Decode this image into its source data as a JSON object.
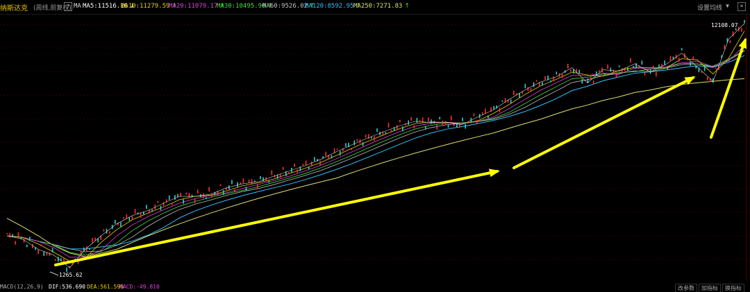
{
  "header": {
    "title": "纳斯达克",
    "subtitle": "(周线,前复权)",
    "help": "?",
    "ma_label": "MA",
    "ma": [
      {
        "label": "MA5:11516.10",
        "arrow": "↓",
        "color": "#ffffff"
      },
      {
        "label": "MA10:11279.59",
        "arrow": "↑",
        "color": "#e6d200"
      },
      {
        "label": "MA20:11079.17",
        "arrow": "↑",
        "color": "#e040e0"
      },
      {
        "label": "MA30:10495.90",
        "arrow": "↑",
        "color": "#40e040"
      },
      {
        "label": "MA60:9526.02",
        "arrow": "↑",
        "color": "#c0c0c0"
      },
      {
        "label": "MA120:8592.95",
        "arrow": "↑",
        "color": "#30c0ff"
      },
      {
        "label": "MA250:7271.83",
        "arrow": "↑",
        "color": "#e0e070"
      }
    ],
    "settings": "设置均线",
    "caret": "▼",
    "close": "×"
  },
  "price_labels": {
    "high": "12108.07",
    "low": "1265.62"
  },
  "macd": {
    "label": "MACD(12,26,9)",
    "dif": "DIF:536.690",
    "dea": "DEA:561.596",
    "macd": "MACD:-49.810",
    "dif_arrow": "↓",
    "dea_arrow": "↓",
    "macd_arrow": "↑"
  },
  "bottom_tabs": [
    "改参数",
    "加指标",
    "换指标"
  ],
  "chart_data": {
    "type": "line",
    "title": "纳斯达克",
    "series": [
      {
        "name": "纳斯达克",
        "values": [
          1700,
          1650,
          1500,
          1420,
          1265.62,
          1500,
          1700,
          1900,
          2050,
          2150,
          2300,
          2450,
          2450,
          2500,
          2650,
          2750,
          2800,
          2950,
          3100,
          3250,
          3450,
          3700,
          3950,
          4200,
          4450,
          4700,
          4900,
          4850,
          4850,
          4750,
          5100,
          5450,
          6000,
          6550,
          7050,
          7400,
          8050,
          7000,
          7900,
          7800,
          8350,
          7750,
          8300,
          9200,
          8100,
          7100,
          10500,
          12108.07
        ]
      },
      {
        "name": "MA250",
        "values": [
          2000,
          1850,
          1700,
          1550,
          1450,
          1400,
          1450,
          1500,
          1600,
          1700,
          1800,
          1900,
          2000,
          2100,
          2200,
          2300,
          2400,
          2500,
          2600,
          2700,
          2800,
          2900,
          3050,
          3200,
          3350,
          3500,
          3650,
          3800,
          3950,
          4100,
          4250,
          4400,
          4600,
          4800,
          5000,
          5250,
          5500,
          5700,
          5950,
          6150,
          6400,
          6550,
          6750,
          6900,
          7000,
          7100,
          7200,
          7271.83
        ]
      }
    ],
    "annotations": [
      "12108.07",
      "1265.62"
    ]
  }
}
